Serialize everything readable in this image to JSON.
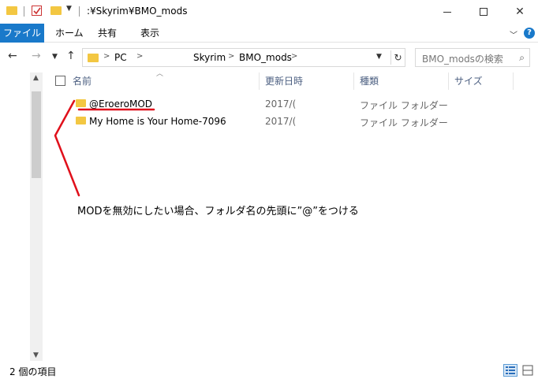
{
  "window": {
    "title": ":¥Skyrim¥BMO_mods"
  },
  "ribbon": {
    "tabs": [
      "ファイル",
      "ホーム",
      "共有",
      "表示"
    ]
  },
  "address": {
    "crumbs": [
      "PC",
      "Skyrim",
      "BMO_mods"
    ]
  },
  "search": {
    "placeholder": "BMO_modsの検索"
  },
  "columns": {
    "name": "名前",
    "date": "更新日時",
    "type": "種類",
    "size": "サイズ"
  },
  "rows": [
    {
      "name": "@EroeroMOD",
      "date": "2017/(",
      "type": "ファイル フォルダー"
    },
    {
      "name": "My Home is Your Home-7096",
      "date": "2017/(",
      "type": "ファイル フォルダー"
    }
  ],
  "annotation": {
    "text": "MODを無効にしたい場合、フォルダ名の先頭に”@”をつける",
    "color": "#e0101b"
  },
  "status": {
    "count_text": "2 個の項目"
  },
  "colors": {
    "accent": "#1979ca",
    "folder": "#f3c742"
  }
}
